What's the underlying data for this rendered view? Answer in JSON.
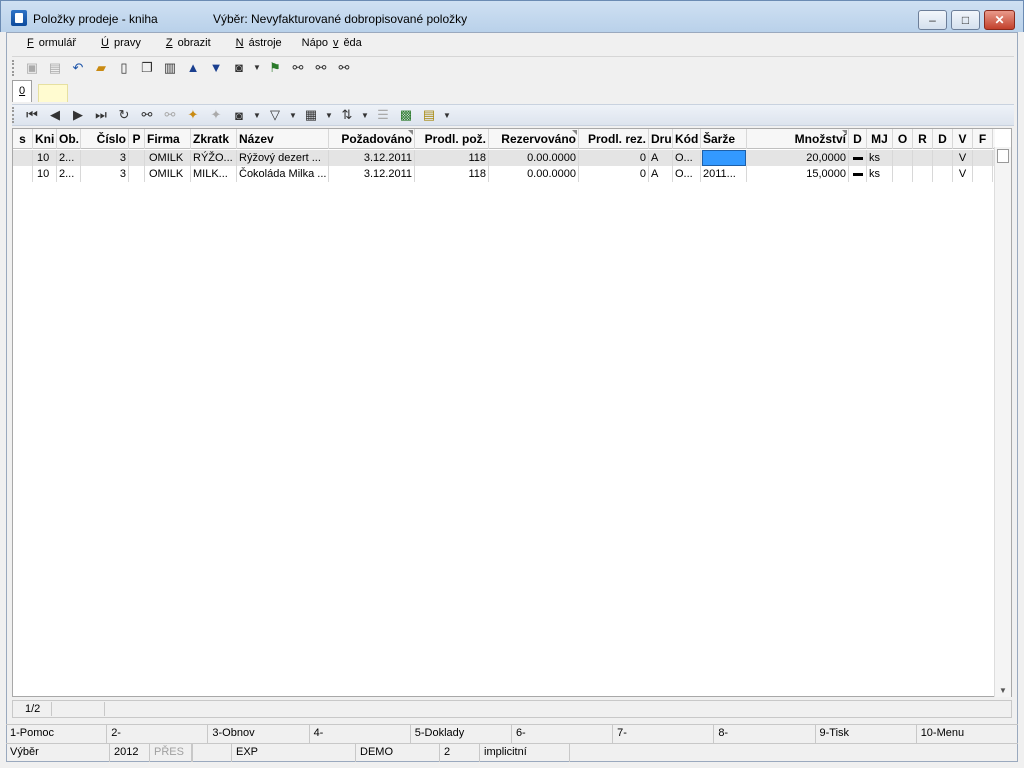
{
  "window": {
    "title": "Položky prodeje - kniha",
    "subtitle": "Výběr: Nevyfakturované dobropisované položky",
    "min_label": "–",
    "max_label": "□",
    "close_label": "✕"
  },
  "menu": [
    {
      "pre": "",
      "u": "F",
      "post": "ormulář"
    },
    {
      "pre": "",
      "u": "Ú",
      "post": "pravy"
    },
    {
      "pre": "",
      "u": "Z",
      "post": "obrazit"
    },
    {
      "pre": "",
      "u": "N",
      "post": "ástroje"
    },
    {
      "pre": "Nápo",
      "u": "v",
      "post": "ěda"
    }
  ],
  "toolbar_icons": [
    "save-icon",
    "save-all-icon",
    "undo-icon",
    "open-folder-icon",
    "new-document-icon",
    "copy-icon",
    "book-icon",
    "arrow-up-icon",
    "arrow-down-icon",
    "camera-icon",
    "binoculars-flag-icon",
    "binoculars-icon",
    "binoculars-next-icon",
    "binoculars-prev-icon"
  ],
  "tabs": {
    "active": "0"
  },
  "columns": [
    {
      "key": "s",
      "label": "s"
    },
    {
      "key": "kni",
      "label": "Kni"
    },
    {
      "key": "ob",
      "label": "Ob."
    },
    {
      "key": "cislo",
      "label": "Číslo"
    },
    {
      "key": "p",
      "label": "P"
    },
    {
      "key": "firma",
      "label": "Firma"
    },
    {
      "key": "zkratka",
      "label": "Zkratk"
    },
    {
      "key": "nazev",
      "label": "Název"
    },
    {
      "key": "pozadovano",
      "label": "Požadováno"
    },
    {
      "key": "prodl_poz",
      "label": "Prodl. pož."
    },
    {
      "key": "rezervovano",
      "label": "Rezervováno"
    },
    {
      "key": "prodl_rez",
      "label": "Prodl. rez."
    },
    {
      "key": "dru",
      "label": "Dru"
    },
    {
      "key": "kod",
      "label": "Kód"
    },
    {
      "key": "sarze",
      "label": "Šarže"
    },
    {
      "key": "mnozstvi",
      "label": "Množství"
    },
    {
      "key": "d",
      "label": "D"
    },
    {
      "key": "mj",
      "label": "MJ"
    },
    {
      "key": "o",
      "label": "O"
    },
    {
      "key": "r",
      "label": "R"
    },
    {
      "key": "d2",
      "label": "D"
    },
    {
      "key": "v",
      "label": "V"
    },
    {
      "key": "f",
      "label": "F"
    }
  ],
  "rows": [
    {
      "s": "",
      "kni": "10",
      "ob": "2...",
      "cislo": "3",
      "p": "",
      "firma": "OMILK",
      "zkratka": "RÝŽO...",
      "nazev": "Rýžový dezert ...",
      "pozadovano": "3.12.2011",
      "prodl_poz": "118",
      "rezervovano": "0.00.0000",
      "prodl_rez": "0",
      "dru": "A",
      "kod": "O...",
      "sarze": "",
      "mnozstvi": "20,0000",
      "mj": "ks",
      "o": "",
      "r": "",
      "d2": "",
      "v": "V",
      "f": ""
    },
    {
      "s": "",
      "kni": "10",
      "ob": "2...",
      "cislo": "3",
      "p": "",
      "firma": "OMILK",
      "zkratka": "MILK...",
      "nazev": "Čokoláda Milka ...",
      "pozadovano": "3.12.2011",
      "prodl_poz": "118",
      "rezervovano": "0.00.0000",
      "prodl_rez": "0",
      "dru": "A",
      "kod": "O...",
      "sarze": "2011...",
      "mnozstvi": "15,0000",
      "mj": "ks",
      "o": "",
      "r": "",
      "d2": "",
      "v": "V",
      "f": ""
    }
  ],
  "record_counter": "1/2",
  "fkeys": [
    "1-Pomoc",
    "2-",
    "3-Obnov",
    "4-",
    "5-Doklady",
    "6-",
    "7-",
    "8-",
    "9-Tisk",
    "10-Menu"
  ],
  "status": {
    "mode": "Výběr",
    "year": "2012",
    "pres": "PŘES",
    "exp": "EXP",
    "db": "DEMO",
    "num": "2",
    "profile": "implicitní"
  }
}
